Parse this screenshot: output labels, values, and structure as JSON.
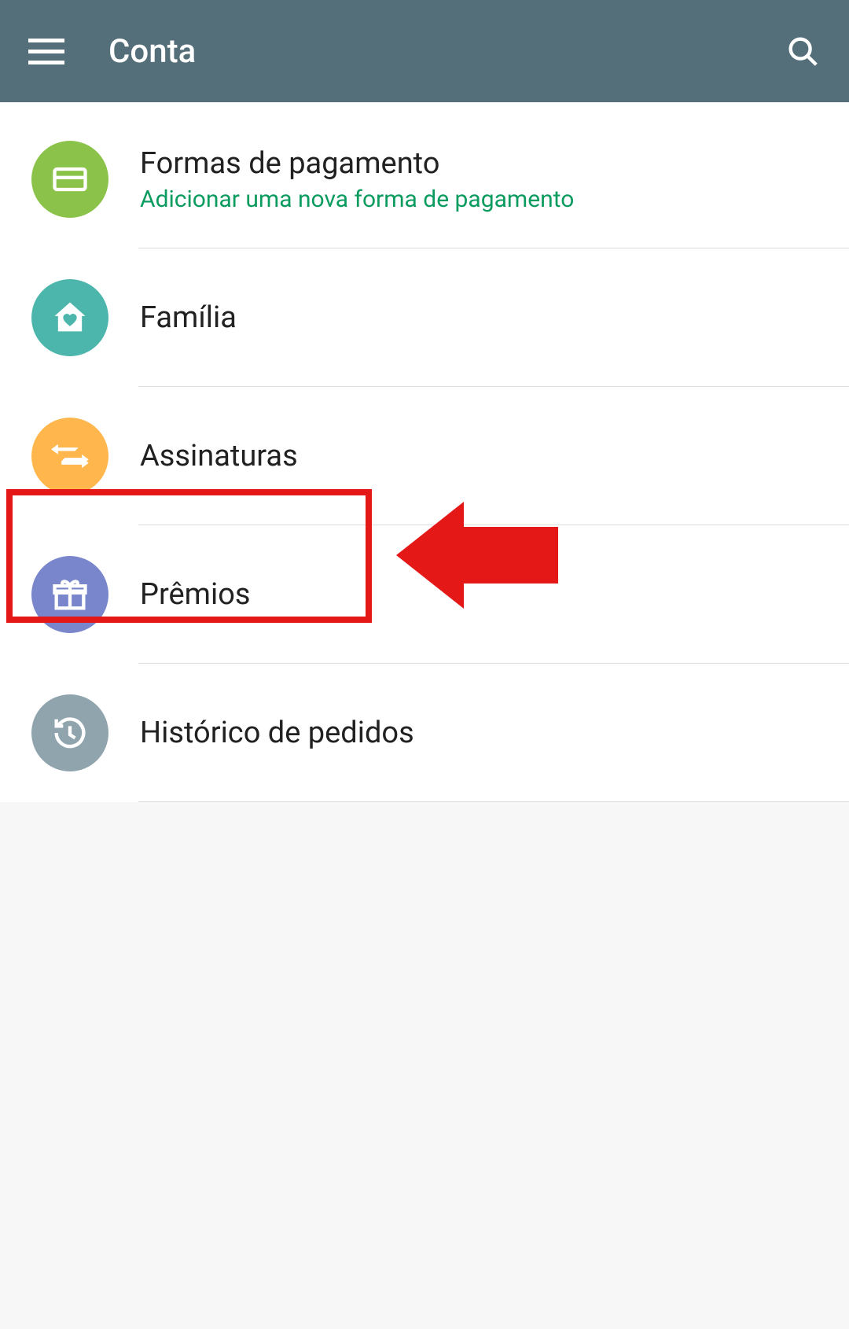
{
  "colors": {
    "appbar": "#546e7a",
    "highlight": "#e51818",
    "link_green": "#0a9b5f"
  },
  "appbar": {
    "title": "Conta",
    "menu_icon": "menu-icon",
    "search_icon": "search-icon"
  },
  "items": [
    {
      "id": "payment",
      "label": "Formas de pagamento",
      "subtitle": "Adicionar uma nova forma de pagamento",
      "icon": "credit-card-icon",
      "circle_color": "#8bc34a"
    },
    {
      "id": "family",
      "label": "Família",
      "icon": "house-heart-icon",
      "circle_color": "#4db6ac"
    },
    {
      "id": "subscriptions",
      "label": "Assinaturas",
      "icon": "loop-arrows-icon",
      "circle_color": "#ffb74d",
      "highlighted": true
    },
    {
      "id": "rewards",
      "label": "Prêmios",
      "icon": "gift-icon",
      "circle_color": "#7986cb"
    },
    {
      "id": "order-history",
      "label": "Histórico de pedidos",
      "icon": "history-icon",
      "circle_color": "#90a4ae"
    }
  ]
}
